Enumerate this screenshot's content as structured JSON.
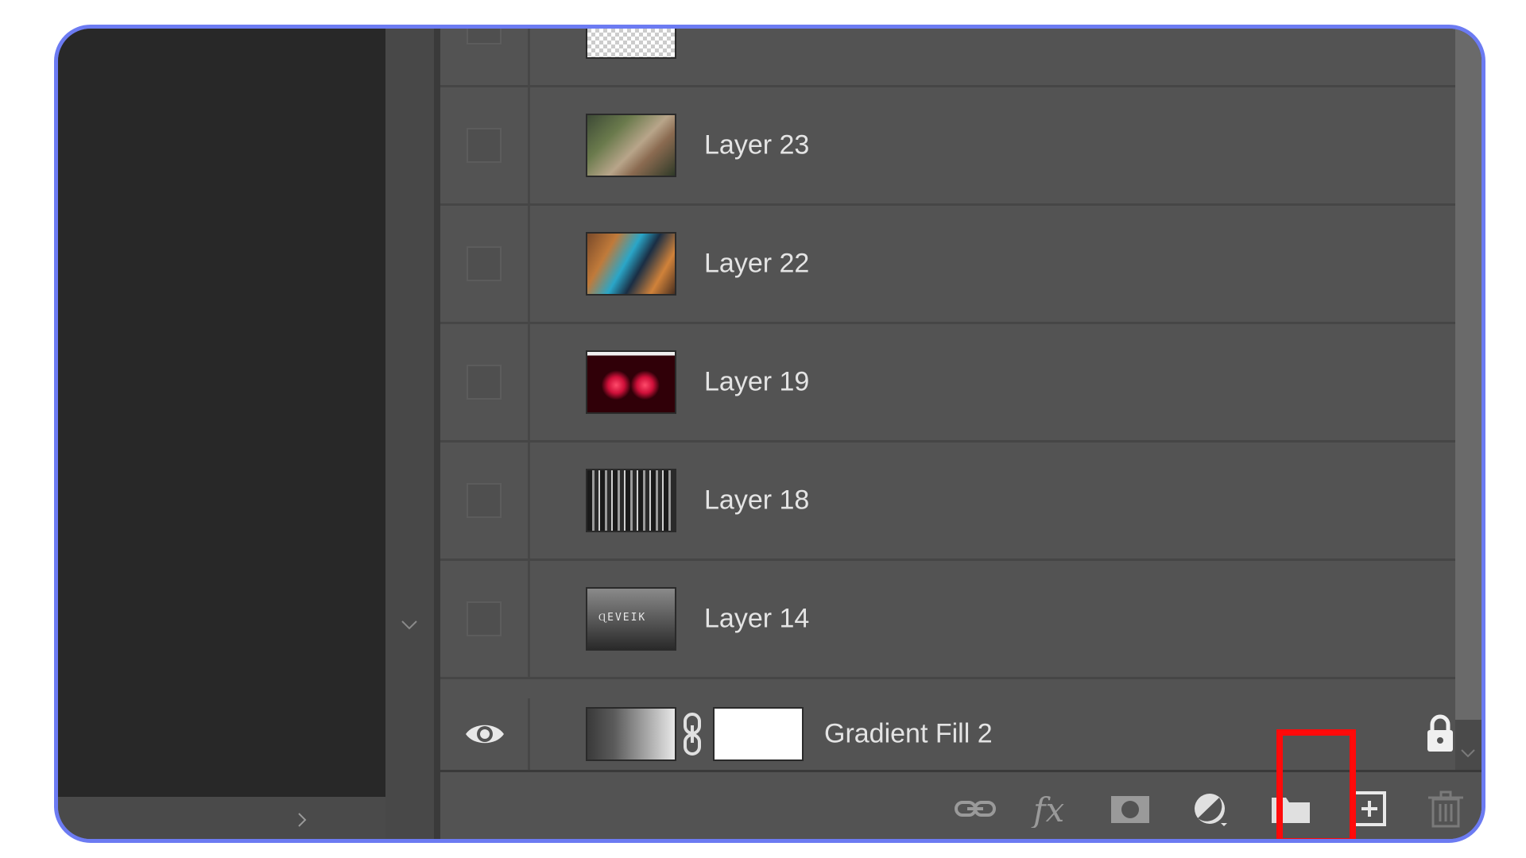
{
  "layers_panel": {
    "layers": [
      {
        "name": "Layer 23",
        "visible": false,
        "thumbnail": "photo-hands-phone"
      },
      {
        "name": "Layer 22",
        "visible": false,
        "thumbnail": "photo-robot-orange"
      },
      {
        "name": "Layer 19",
        "visible": false,
        "thumbnail": "photo-red-lights"
      },
      {
        "name": "Layer 18",
        "visible": false,
        "thumbnail": "photo-bw-collage"
      },
      {
        "name": "Layer 14",
        "visible": false,
        "thumbnail": "photo-dark-title",
        "thumbnail_text": "ɊEVEIK"
      }
    ],
    "fill_layer": {
      "name": "Gradient Fill 2",
      "visible": true,
      "locked": true
    }
  },
  "toolbar": {
    "icons": [
      "link-layers-icon",
      "fx-icon",
      "add-mask-icon",
      "adjustment-layer-icon",
      "new-group-icon",
      "new-layer-icon",
      "delete-layer-icon"
    ],
    "highlighted": "new-layer-icon"
  },
  "colors": {
    "panel_bg": "#535353",
    "canvas_bg": "#282828",
    "frame_border": "#6c7bf2",
    "highlight": "#ff0a0a",
    "text": "#e4e4e4"
  }
}
